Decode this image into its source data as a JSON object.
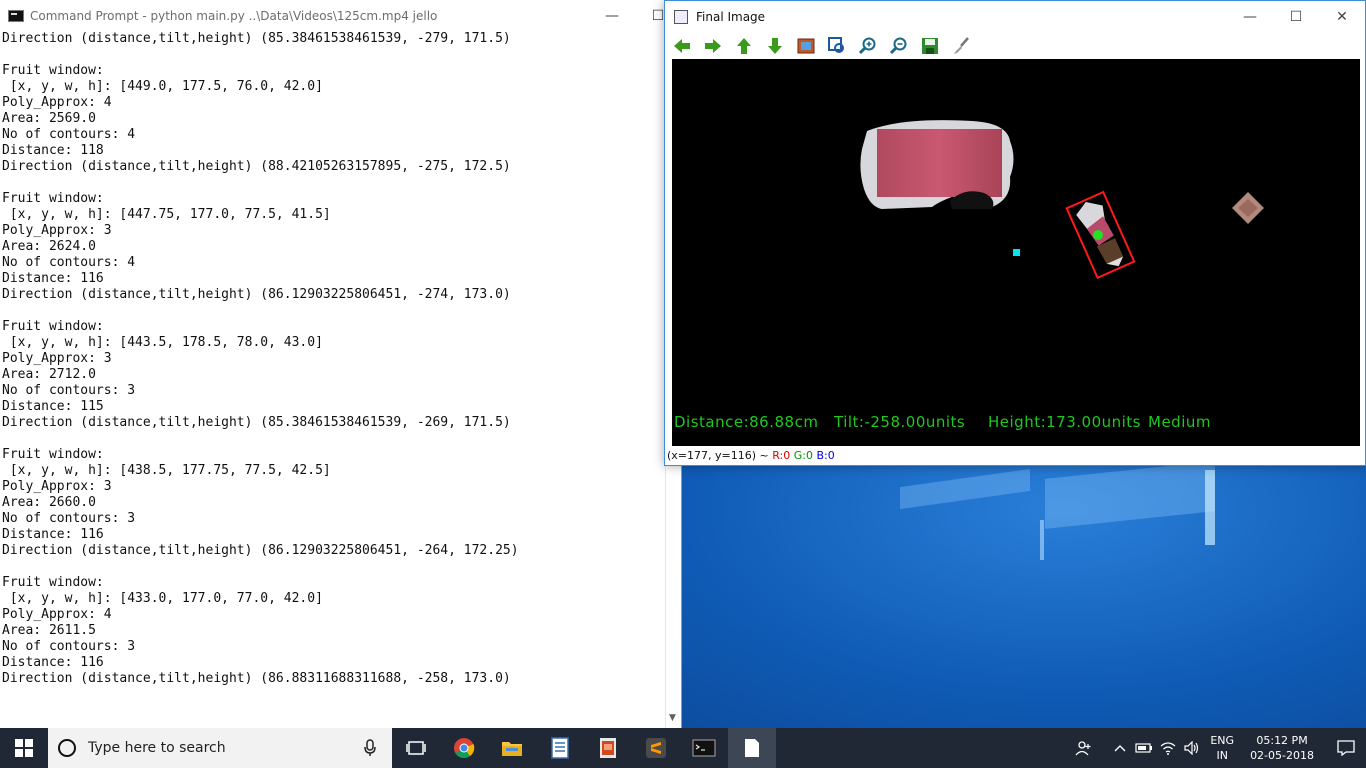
{
  "cmd": {
    "title": "Command Prompt - python  main.py ..\\Data\\Videos\\125cm.mp4 jello",
    "lines": [
      "Direction (distance,tilt,height) (85.38461538461539, -279, 171.5)",
      "",
      "Fruit window:",
      " [x, y, w, h]: [449.0, 177.5, 76.0, 42.0]",
      "Poly_Approx: 4",
      "Area: 2569.0",
      "No of contours: 4",
      "Distance: 118",
      "Direction (distance,tilt,height) (88.42105263157895, -275, 172.5)",
      "",
      "Fruit window:",
      " [x, y, w, h]: [447.75, 177.0, 77.5, 41.5]",
      "Poly_Approx: 3",
      "Area: 2624.0",
      "No of contours: 4",
      "Distance: 116",
      "Direction (distance,tilt,height) (86.12903225806451, -274, 173.0)",
      "",
      "Fruit window:",
      " [x, y, w, h]: [443.5, 178.5, 78.0, 43.0]",
      "Poly_Approx: 3",
      "Area: 2712.0",
      "No of contours: 3",
      "Distance: 115",
      "Direction (distance,tilt,height) (85.38461538461539, -269, 171.5)",
      "",
      "Fruit window:",
      " [x, y, w, h]: [438.5, 177.75, 77.5, 42.5]",
      "Poly_Approx: 3",
      "Area: 2660.0",
      "No of contours: 3",
      "Distance: 116",
      "Direction (distance,tilt,height) (86.12903225806451, -264, 172.25)",
      "",
      "Fruit window:",
      " [x, y, w, h]: [433.0, 177.0, 77.0, 42.0]",
      "Poly_Approx: 4",
      "Area: 2611.5",
      "No of contours: 3",
      "Distance: 116",
      "Direction (distance,tilt,height) (86.88311688311688, -258, 173.0)"
    ]
  },
  "final_image": {
    "title": "Final Image",
    "overlay": {
      "distance": "Distance:86.88cm",
      "tilt": "Tilt:-258.00units",
      "height": "Height:173.00units",
      "size": "Medium"
    },
    "status": {
      "coords": "(x=177, y=116) ~ ",
      "r": "R:0",
      "g": "G:0",
      "b": "B:0"
    }
  },
  "window_buttons": {
    "minimize": "—",
    "maximize": "☐",
    "close": "✕"
  },
  "taskbar": {
    "search_placeholder": "Type here to search",
    "language_line1": "ENG",
    "language_line2": "IN",
    "time": "05:12 PM",
    "date": "02-05-2018"
  },
  "colors": {
    "overlay_text": "#1ec81e",
    "taskbar": "#1f2834",
    "detect_box": "#ff1a1a"
  }
}
